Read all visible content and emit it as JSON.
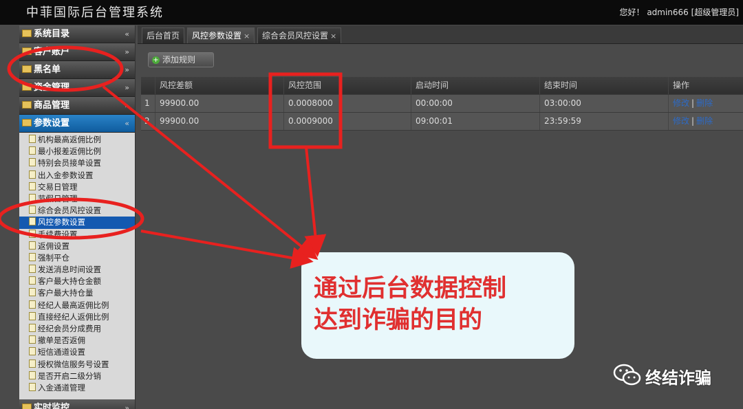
{
  "header": {
    "title": "中菲国际后台管理系统",
    "user_text": "您好！ admin666 [超级管理员]"
  },
  "sidebar": {
    "sections": [
      {
        "label": "系统目录",
        "chev": "«"
      },
      {
        "label": "客户账户",
        "chev": "»"
      },
      {
        "label": "黑名单",
        "chev": "»"
      },
      {
        "label": "资金管理",
        "chev": "»"
      },
      {
        "label": "商品管理",
        "chev": "»"
      },
      {
        "label": "参数设置",
        "chev": "«"
      }
    ],
    "items": [
      "机构最高返佣比例",
      "最小报差返佣比例",
      "特别会员接单设置",
      "出入金参数设置",
      "交易日管理",
      "节假日管理",
      "综合会员风控设置",
      "风控参数设置",
      "手续费设置",
      "返佣设置",
      "强制平仓",
      "发送消息时间设置",
      "客户最大持仓金额",
      "客户最大持仓量",
      "经纪人最高返佣比例",
      "直接经纪人返佣比例",
      "经纪会员分成费用",
      "撤单是否返佣",
      "短信通道设置",
      "授权微信服务号设置",
      "是否开启二级分销",
      "入金通道管理"
    ],
    "selected_item": "风控参数设置",
    "bottom_section": {
      "label": "实时监控",
      "chev": "»"
    }
  },
  "tabs": [
    {
      "label": "后台首页",
      "closable": false
    },
    {
      "label": "风控参数设置",
      "closable": true
    },
    {
      "label": "综合会员风控设置",
      "closable": true
    }
  ],
  "toolbar": {
    "add_rule_label": "添加规则"
  },
  "grid": {
    "columns": [
      "风控差额",
      "风控范围",
      "启动时间",
      "结束时间",
      "操作"
    ],
    "rows": [
      {
        "index": "1",
        "cells": [
          "99900.00",
          "0.0008000",
          "00:00:00",
          "03:00:00"
        ]
      },
      {
        "index": "2",
        "cells": [
          "99900.00",
          "0.0009000",
          "09:00:01",
          "23:59:59"
        ]
      }
    ],
    "action_labels": [
      "修改",
      "删除"
    ],
    "action_separator": "|"
  },
  "callout": {
    "lines": [
      "通过后台数据控制",
      "达到诈骗的目的"
    ]
  },
  "watermark": {
    "text": "终结诈骗",
    "icon": "wechat-icon"
  },
  "colors": {
    "annotation_red": "#e8211f",
    "callout_bg": "#e9f8fb",
    "callout_text": "#e03030",
    "selected_bg": "#1459b0",
    "active_section": "#1f74b8"
  }
}
